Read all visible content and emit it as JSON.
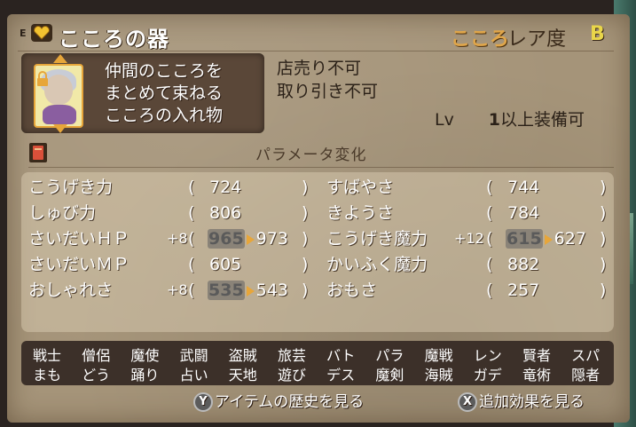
{
  "header": {
    "equip_mark": "E",
    "item_name": "こころの器",
    "rarity_label_a": "こころ",
    "rarity_label_b": "レア度",
    "rarity_value": "B"
  },
  "description": {
    "line1": "仲間のこころを",
    "line2": "まとめて束ねる",
    "line3": "こころの入れ物"
  },
  "restrictions": {
    "sell": "店売り不可",
    "trade": "取り引き不可",
    "lv_label": "Lv",
    "lv_value": "1",
    "lv_suffix": "以上装備可"
  },
  "params": {
    "title": "パラメータ変化",
    "stats": [
      {
        "name": "こうげき力",
        "bonus": "",
        "old": "",
        "value": "724"
      },
      {
        "name": "しゅび力",
        "bonus": "",
        "old": "",
        "value": "806"
      },
      {
        "name": "さいだいＨＰ",
        "bonus": "+8",
        "old": "965",
        "value": "973"
      },
      {
        "name": "さいだいＭＰ",
        "bonus": "",
        "old": "",
        "value": "605"
      },
      {
        "name": "おしゃれさ",
        "bonus": "+8",
        "old": "535",
        "value": "543"
      },
      {
        "name": "すばやさ",
        "bonus": "",
        "old": "",
        "value": "744"
      },
      {
        "name": "きようさ",
        "bonus": "",
        "old": "",
        "value": "784"
      },
      {
        "name": "こうげき魔力",
        "bonus": "+12",
        "old": "615",
        "value": "627"
      },
      {
        "name": "かいふく魔力",
        "bonus": "",
        "old": "",
        "value": "882"
      },
      {
        "name": "おもさ",
        "bonus": "",
        "old": "",
        "value": "257"
      }
    ]
  },
  "jobs": {
    "row1": [
      "戦士",
      "僧侶",
      "魔使",
      "武闘",
      "盗賊",
      "旅芸",
      "バト",
      "パラ",
      "魔戦",
      "レン",
      "賢者",
      "スパ"
    ],
    "row2": [
      "まも",
      "どう",
      "踊り",
      "占い",
      "天地",
      "遊び",
      "デス",
      "魔剣",
      "海賊",
      "ガデ",
      "竜術",
      "隠者"
    ]
  },
  "hints": {
    "y_button": "Y",
    "y_label": "アイテムの歴史を見る",
    "x_button": "X",
    "x_label": "追加効果を見る"
  },
  "colors": {
    "parchment": "#a59479",
    "accent_orange": "#e7a63a",
    "rarity_value": "#e9d64a",
    "dark_box": "#3c3029"
  }
}
